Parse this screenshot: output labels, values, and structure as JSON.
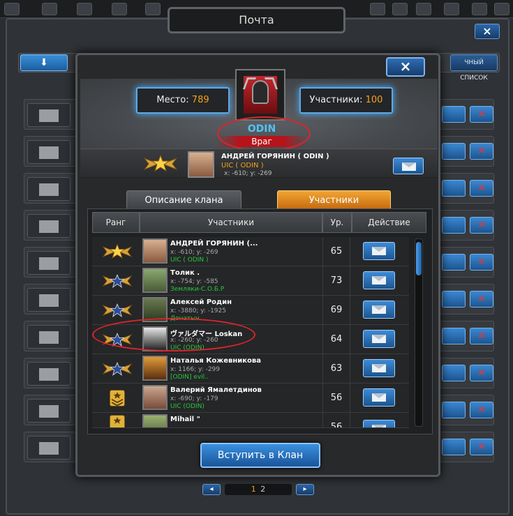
{
  "mail": {
    "title": "Почта",
    "close_label": "×",
    "list_button": "ЧНЫЙ СПИСОК",
    "pager": {
      "current": "1",
      "other": "2",
      "prev": "◂",
      "next": "▸"
    }
  },
  "modal": {
    "close_label": "×",
    "place_label": "Место:",
    "place_value": "789",
    "members_label": "Участники:",
    "members_value": "100",
    "clan_name": "ODIN",
    "clan_status": "Враг",
    "leader": {
      "name": "АНДРЕЙ ГОРЯНИН ( ODIN )",
      "clan": "UIC ( ODIN )",
      "coords": "x: -610; y: -269"
    },
    "tabs": [
      {
        "label": "Описание клана",
        "active": false
      },
      {
        "label": "Участники",
        "active": true
      }
    ],
    "table": {
      "headers": [
        "Ранг",
        "Участники",
        "Ур.",
        "Действие"
      ],
      "rows": [
        {
          "rank": "gold-wings-star",
          "name": "АНДРЕЙ ГОРЯНИН (...",
          "coords": "x: -610; y: -269",
          "clan": "UIC ( ODIN )",
          "level": "65"
        },
        {
          "rank": "silver-wings-star",
          "name": "Толик .",
          "coords": "x: -754; y: -585",
          "clan": "Земляки-С.О.Б.Р",
          "level": "73"
        },
        {
          "rank": "silver-wings-star",
          "name": "Алексей Родин",
          "coords": "x: -3880; y: -1925",
          "clan": "Донатыч",
          "level": "69"
        },
        {
          "rank": "silver-wings-star",
          "name": "ヴァルダマー Loskan",
          "coords": "x: -260; y: -260",
          "clan": "UIC (ODIN)",
          "level": "64"
        },
        {
          "rank": "silver-wings-star",
          "name": "Наталья Кожевникова",
          "coords": "x: 1166; y: -299",
          "clan": "[ODIN] evil..",
          "level": "63"
        },
        {
          "rank": "gold-chevron",
          "name": "Валерий Ямалетдинов",
          "coords": "x: -690; y: -179",
          "clan": "UIC (ODIN)",
          "level": "56"
        },
        {
          "rank": "gold-chevron",
          "name": "Mihail \"",
          "coords": "",
          "clan": "",
          "level": "56"
        }
      ]
    },
    "join_button": "Вступить в Клан"
  }
}
